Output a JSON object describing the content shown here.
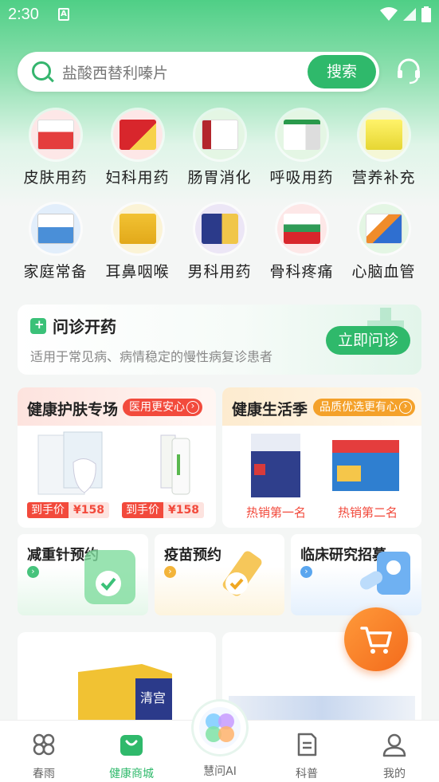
{
  "status_bar": {
    "time": "2:30",
    "notif_letter": "A"
  },
  "search": {
    "placeholder": "盐酸西替利嗪片",
    "button": "搜索"
  },
  "categories_row1": [
    "皮肤用药",
    "妇科用药",
    "肠胃消化",
    "呼吸用药",
    "营养补充"
  ],
  "categories_row2": [
    "家庭常备",
    "耳鼻咽喉",
    "男科用药",
    "骨科疼痛",
    "心脑血管"
  ],
  "consult": {
    "title": "问诊开药",
    "subtitle": "适用于常见病、病情稳定的慢性病复诊患者",
    "button": "立即问诊"
  },
  "promo_skin": {
    "title": "健康护肤专场",
    "tag": "医用更安心",
    "prices": [
      {
        "label": "到手价",
        "value": "¥158"
      },
      {
        "label": "到手价",
        "value": "¥158"
      }
    ]
  },
  "promo_life": {
    "title": "健康生活季",
    "tag": "品质优选更有心",
    "ranks": [
      "热销第一名",
      "热销第二名"
    ]
  },
  "services": [
    {
      "title": "减重针预约"
    },
    {
      "title": "疫苗预约"
    },
    {
      "title": "临床研究招募"
    }
  ],
  "tabs": [
    {
      "label": "春雨",
      "active": false
    },
    {
      "label": "健康商城",
      "active": true
    },
    {
      "label": "慧问AI",
      "active": false
    },
    {
      "label": "科普",
      "active": false
    },
    {
      "label": "我的",
      "active": false
    }
  ],
  "colors": {
    "brand_green": "#2fb96b",
    "price_red": "#f24a3c",
    "cart_orange": "#f36b1c"
  }
}
